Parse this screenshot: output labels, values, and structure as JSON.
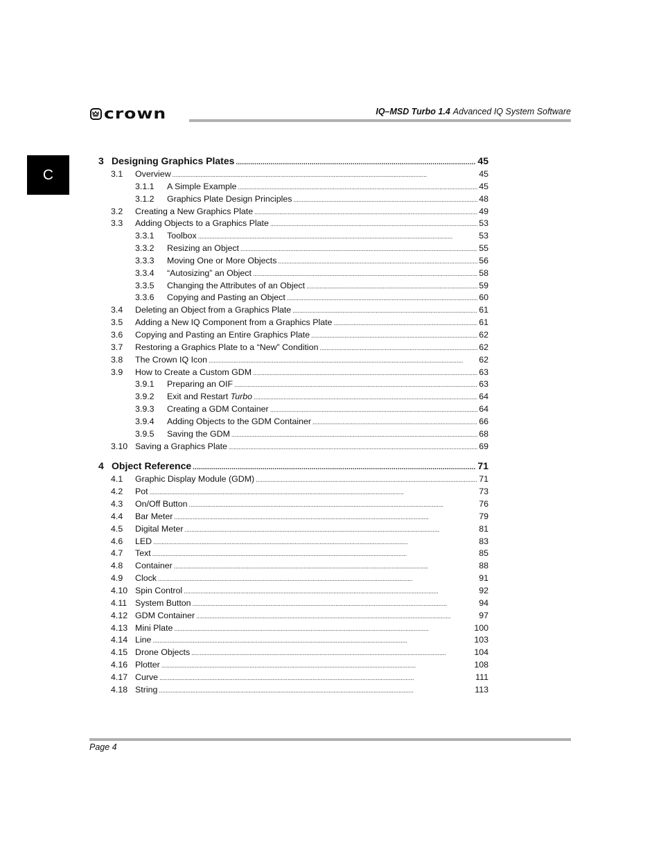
{
  "side_tab": {
    "label": "C"
  },
  "header": {
    "brand": "crown",
    "title_bold": "IQ–MSD Turbo 1.4",
    "title_rest": "Advanced IQ System Software"
  },
  "toc": {
    "chapters": [
      {
        "number": "3",
        "title": "Designing Graphics Plates",
        "page": "45",
        "entries": [
          {
            "level": 2,
            "number": "3.1",
            "title": "Overview",
            "page": "45"
          },
          {
            "level": 3,
            "number": "3.1.1",
            "title": "A Simple Example",
            "page": "45"
          },
          {
            "level": 3,
            "number": "3.1.2",
            "title": "Graphics Plate Design Principles",
            "page": "48"
          },
          {
            "level": 2,
            "number": "3.2",
            "title": "Creating a New Graphics Plate",
            "page": "49"
          },
          {
            "level": 2,
            "number": "3.3",
            "title": "Adding Objects to a Graphics Plate",
            "page": "53"
          },
          {
            "level": 3,
            "number": "3.3.1",
            "title": "Toolbox",
            "page": "53"
          },
          {
            "level": 3,
            "number": "3.3.2",
            "title": "Resizing an Object",
            "page": "55"
          },
          {
            "level": 3,
            "number": "3.3.3",
            "title": "Moving One or More Objects",
            "page": "56"
          },
          {
            "level": 3,
            "number": "3.3.4",
            "title": "“Autosizing” an Object",
            "page": "58"
          },
          {
            "level": 3,
            "number": "3.3.5",
            "title": "Changing the Attributes of an Object",
            "page": "59"
          },
          {
            "level": 3,
            "number": "3.3.6",
            "title": "Copying and Pasting an Object",
            "page": "60"
          },
          {
            "level": 2,
            "number": "3.4",
            "title": "Deleting an Object from a Graphics Plate",
            "page": "61"
          },
          {
            "level": 2,
            "number": "3.5",
            "title": "Adding a New IQ Component from a Graphics Plate",
            "page": "61"
          },
          {
            "level": 2,
            "number": "3.6",
            "title": "Copying and Pasting an Entire Graphics Plate",
            "page": "62"
          },
          {
            "level": 2,
            "number": "3.7",
            "title": "Restoring a Graphics Plate to a “New” Condition",
            "page": "62"
          },
          {
            "level": 2,
            "number": "3.8",
            "title": "The Crown IQ Icon",
            "page": "62"
          },
          {
            "level": 2,
            "number": "3.9",
            "title": "How to Create a Custom GDM",
            "page": "63"
          },
          {
            "level": 3,
            "number": "3.9.1",
            "title": "Preparing an OIF",
            "page": "63"
          },
          {
            "level": 3,
            "number": "3.9.2",
            "title": "Exit and Restart ",
            "title_italic": "Turbo",
            "page": "64"
          },
          {
            "level": 3,
            "number": "3.9.3",
            "title": "Creating a GDM Container",
            "page": "64"
          },
          {
            "level": 3,
            "number": "3.9.4",
            "title": "Adding Objects to the GDM Container",
            "page": "66"
          },
          {
            "level": 3,
            "number": "3.9.5",
            "title": "Saving the GDM",
            "page": "68"
          },
          {
            "level": 2,
            "number": "3.10",
            "title": "Saving a Graphics Plate",
            "page": "69"
          }
        ]
      },
      {
        "number": "4",
        "title": "Object Reference",
        "page": "71",
        "entries": [
          {
            "level": 2,
            "number": "4.1",
            "title": "Graphic Display Module (GDM)",
            "page": "71"
          },
          {
            "level": 2,
            "number": "4.2",
            "title": "Pot",
            "page": "73"
          },
          {
            "level": 2,
            "number": "4.3",
            "title": "On/Off Button",
            "page": "76"
          },
          {
            "level": 2,
            "number": "4.4",
            "title": "Bar Meter",
            "page": "79"
          },
          {
            "level": 2,
            "number": "4.5",
            "title": "Digital Meter",
            "page": "81"
          },
          {
            "level": 2,
            "number": "4.6",
            "title": "LED",
            "page": "83"
          },
          {
            "level": 2,
            "number": "4.7",
            "title": "Text",
            "page": "85"
          },
          {
            "level": 2,
            "number": "4.8",
            "title": "Container",
            "page": "88"
          },
          {
            "level": 2,
            "number": "4.9",
            "title": "Clock",
            "page": "91"
          },
          {
            "level": 2,
            "number": "4.10",
            "title": "Spin Control",
            "page": "92"
          },
          {
            "level": 2,
            "number": "4.11",
            "title": "System Button",
            "page": "94"
          },
          {
            "level": 2,
            "number": "4.12",
            "title": "GDM Container",
            "page": "97"
          },
          {
            "level": 2,
            "number": "4.13",
            "title": "Mini Plate",
            "page": "100"
          },
          {
            "level": 2,
            "number": "4.14",
            "title": "Line",
            "page": "103"
          },
          {
            "level": 2,
            "number": "4.15",
            "title": "Drone Objects",
            "page": "104"
          },
          {
            "level": 2,
            "number": "4.16",
            "title": "Plotter",
            "page": "108"
          },
          {
            "level": 2,
            "number": "4.17",
            "title": "Curve",
            "page": "111"
          },
          {
            "level": 2,
            "number": "4.18",
            "title": "String",
            "page": "113"
          }
        ]
      }
    ]
  },
  "footer": {
    "page_label": "Page 4"
  }
}
